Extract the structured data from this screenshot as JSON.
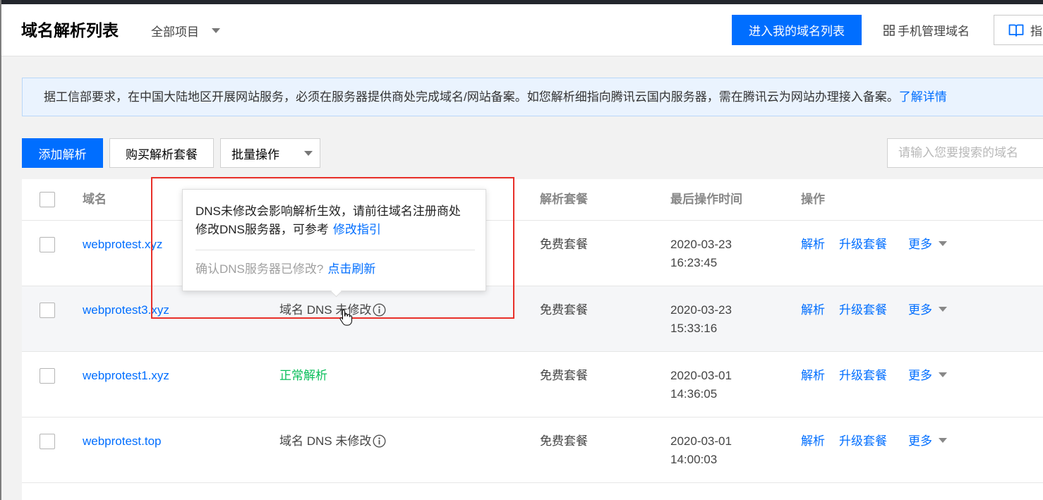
{
  "header": {
    "title": "域名解析列表",
    "project_filter": "全部项目",
    "domain_list_button": "进入我的域名列表",
    "mobile_manage": "手机管理域名",
    "guide_button": "指"
  },
  "notice": {
    "text": "据工信部要求，在中国大陆地区开展网站服务，必须在服务器提供商处完成域名/网站备案。如您解析细指向腾讯云国内服务器，需在腾讯云为网站办理接入备案。",
    "link": "了解详情"
  },
  "toolbar": {
    "add_record_button": "添加解析",
    "buy_package_button": "购买解析套餐",
    "batch_operation": "批量操作",
    "search_placeholder": "请输入您要搜索的域名"
  },
  "table": {
    "columns": {
      "domain": "域名",
      "package": "解析套餐",
      "last_operation_time": "最后操作时间",
      "actions": "操作"
    },
    "actions": {
      "resolve": "解析",
      "upgrade": "升级套餐",
      "more": "更多"
    },
    "rows": [
      {
        "domain": "webprotest.xyz",
        "package": "免费套餐",
        "date": "2020-03-23",
        "time": "16:23:45"
      },
      {
        "domain": "webprotest3.xyz",
        "status": "域名 DNS 未修改",
        "status_icon": "info-icon",
        "package": "免费套餐",
        "date": "2020-03-23",
        "time": "15:33:16",
        "hovered": true
      },
      {
        "domain": "webprotest1.xyz",
        "status": "正常解析",
        "status_color": "#0abf5b",
        "package": "免费套餐",
        "date": "2020-03-01",
        "time": "14:36:05"
      },
      {
        "domain": "webprotest.top",
        "status": "域名 DNS 未修改",
        "status_icon": "info-icon",
        "package": "免费套餐",
        "date": "2020-03-01",
        "time": "14:00:03"
      }
    ]
  },
  "tooltip": {
    "message_line1": "DNS未修改会影响解析生效，请前往域名注册商处",
    "message_line2": "修改DNS服务器，可参考",
    "guide_link": "修改指引",
    "confirm_text": "确认DNS服务器已修改?",
    "refresh_link": "点击刷新"
  },
  "colors": {
    "primary": "#006eff",
    "success": "#0abf5b",
    "annotation": "#e8302a",
    "notice_background": "#eaf3fe"
  }
}
